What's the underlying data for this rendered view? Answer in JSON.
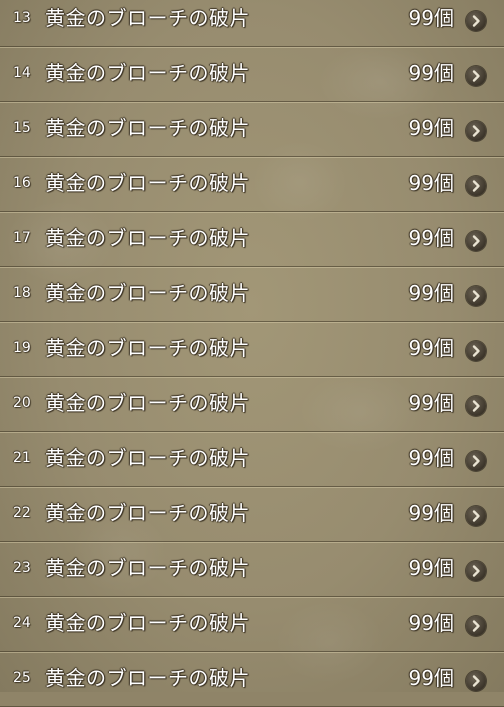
{
  "rows": [
    {
      "index": "13",
      "name": "黄金のブローチの破片",
      "qty": "99個"
    },
    {
      "index": "14",
      "name": "黄金のブローチの破片",
      "qty": "99個"
    },
    {
      "index": "15",
      "name": "黄金のブローチの破片",
      "qty": "99個"
    },
    {
      "index": "16",
      "name": "黄金のブローチの破片",
      "qty": "99個"
    },
    {
      "index": "17",
      "name": "黄金のブローチの破片",
      "qty": "99個"
    },
    {
      "index": "18",
      "name": "黄金のブローチの破片",
      "qty": "99個"
    },
    {
      "index": "19",
      "name": "黄金のブローチの破片",
      "qty": "99個"
    },
    {
      "index": "20",
      "name": "黄金のブローチの破片",
      "qty": "99個"
    },
    {
      "index": "21",
      "name": "黄金のブローチの破片",
      "qty": "99個"
    },
    {
      "index": "22",
      "name": "黄金のブローチの破片",
      "qty": "99個"
    },
    {
      "index": "23",
      "name": "黄金のブローチの破片",
      "qty": "99個"
    },
    {
      "index": "24",
      "name": "黄金のブローチの破片",
      "qty": "99個"
    },
    {
      "index": "25",
      "name": "黄金のブローチの破片",
      "qty": "99個"
    }
  ],
  "row_icon": "chevron-right-icon",
  "colors": {
    "background": "#978c6f",
    "text": "#ffffff",
    "text_outline": "#3a3122",
    "chevron_bg": "#3c352a"
  }
}
